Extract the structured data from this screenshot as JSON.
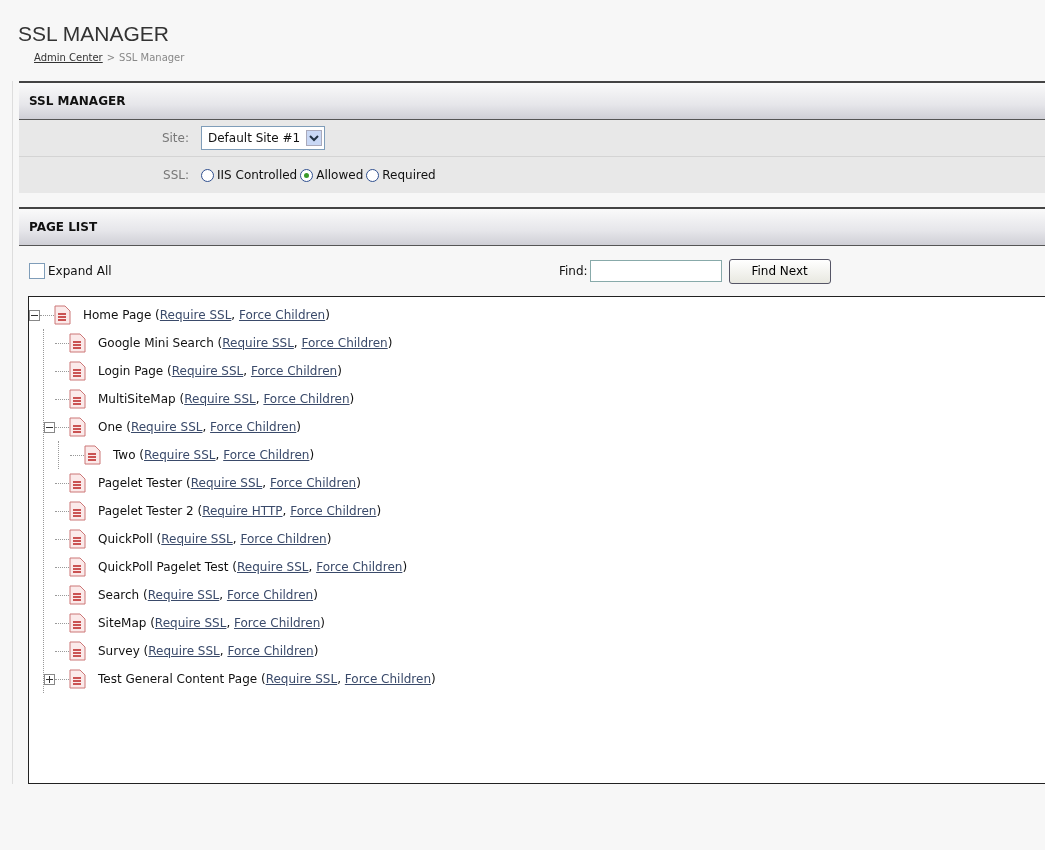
{
  "page_title": "SSL MANAGER",
  "breadcrumb": {
    "link": "Admin Center",
    "separator": ">",
    "current": "SSL Manager"
  },
  "ssl_panel": {
    "title": "SSL MANAGER",
    "site": {
      "label": "Site:",
      "value": "Default Site #1"
    },
    "ssl": {
      "label": "SSL:",
      "options": [
        {
          "label": "IIS Controlled",
          "selected": false
        },
        {
          "label": "Allowed",
          "selected": true
        },
        {
          "label": "Required",
          "selected": false
        }
      ]
    }
  },
  "page_list": {
    "title": "PAGE LIST",
    "expand_all": {
      "label": "Expand All",
      "checked": false
    },
    "find": {
      "label": "Find:",
      "button": "Find Next"
    },
    "punctuation": {
      "open": "(",
      "separator": ", ",
      "close": ")"
    },
    "tree": [
      {
        "name": "Home Page",
        "links": [
          "Require SSL",
          "Force Children"
        ],
        "expanded": true,
        "children": [
          {
            "name": "Google Mini Search",
            "links": [
              "Require SSL",
              "Force Children"
            ]
          },
          {
            "name": "Login Page",
            "links": [
              "Require SSL",
              "Force Children"
            ]
          },
          {
            "name": "MultiSiteMap",
            "links": [
              "Require SSL",
              "Force Children"
            ]
          },
          {
            "name": "One",
            "links": [
              "Require SSL",
              "Force Children"
            ],
            "expanded": true,
            "children": [
              {
                "name": "Two",
                "links": [
                  "Require SSL",
                  "Force Children"
                ]
              }
            ]
          },
          {
            "name": "Pagelet Tester",
            "links": [
              "Require SSL",
              "Force Children"
            ]
          },
          {
            "name": "Pagelet Tester 2",
            "links": [
              "Require HTTP",
              "Force Children"
            ]
          },
          {
            "name": "QuickPoll",
            "links": [
              "Require SSL",
              "Force Children"
            ]
          },
          {
            "name": "QuickPoll Pagelet Test",
            "links": [
              "Require SSL",
              "Force Children"
            ]
          },
          {
            "name": "Search",
            "links": [
              "Require SSL",
              "Force Children"
            ]
          },
          {
            "name": "SiteMap",
            "links": [
              "Require SSL",
              "Force Children"
            ]
          },
          {
            "name": "Survey",
            "links": [
              "Require SSL",
              "Force Children"
            ]
          },
          {
            "name": "Test General Content Page",
            "links": [
              "Require SSL",
              "Force Children"
            ],
            "expanded": false
          }
        ]
      }
    ]
  }
}
